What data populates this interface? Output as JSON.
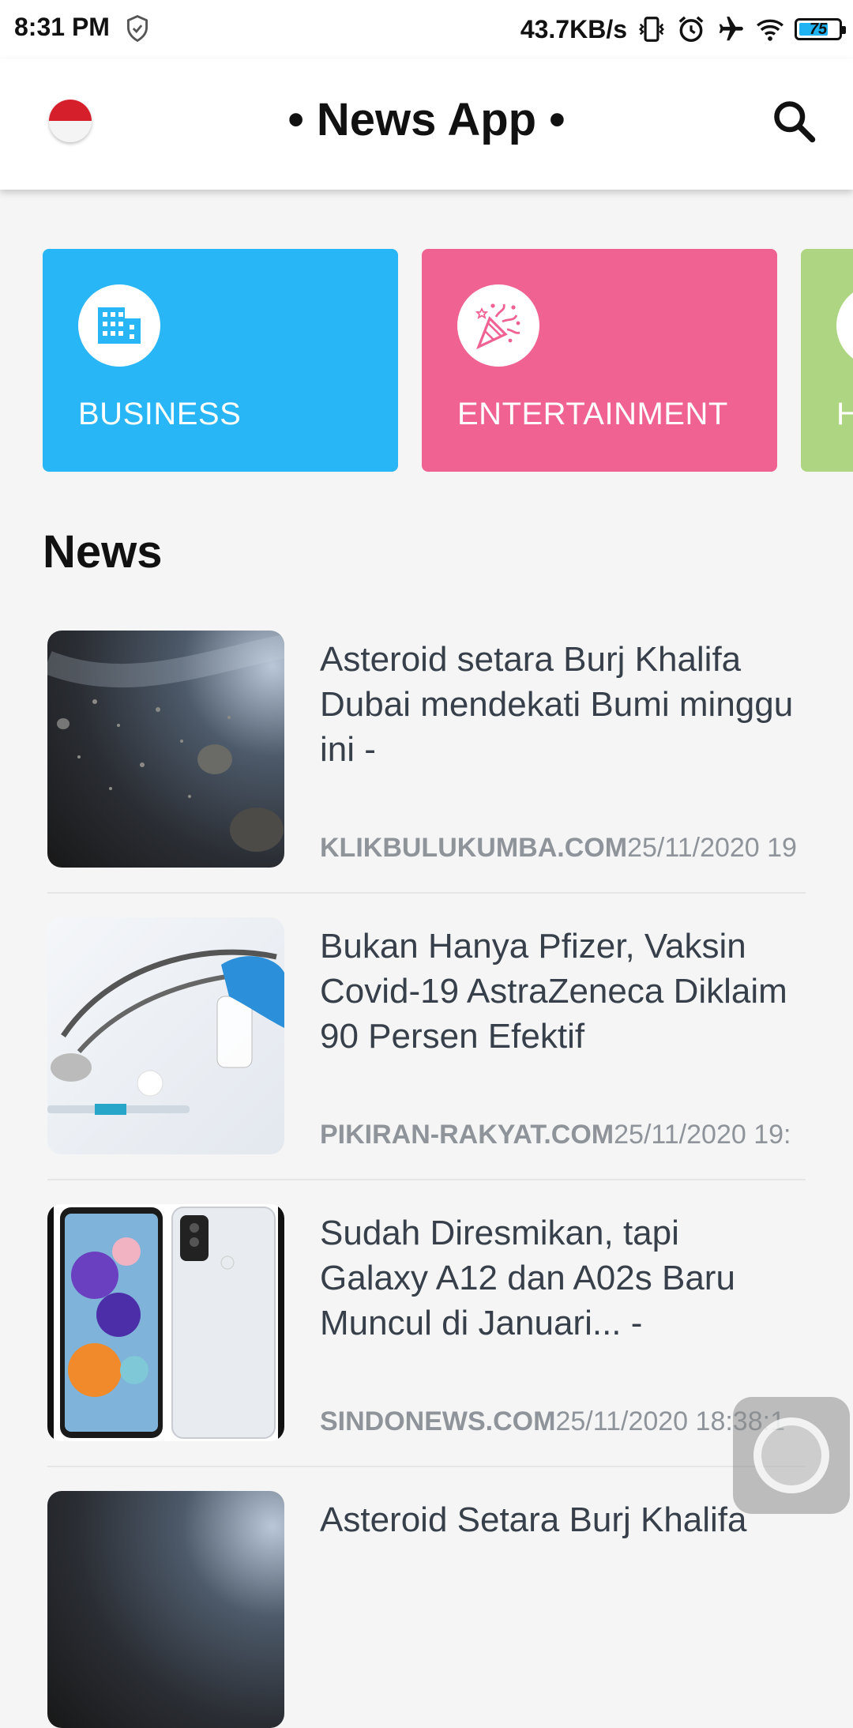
{
  "status_bar": {
    "time": "8:31 PM",
    "net_speed": "43.7KB/s",
    "battery": "75",
    "battery_level": 0.75,
    "icons": [
      "shield-icon",
      "vibrate-icon",
      "alarm-icon",
      "airplane-icon",
      "wifi-icon",
      "battery-icon"
    ]
  },
  "app_bar": {
    "title": "• News App •",
    "flag_icon": "indonesia-flag-icon",
    "search_icon": "search-icon"
  },
  "categories": [
    {
      "label": "BUSINESS",
      "color": "#29b6f6",
      "icon": "business-building-icon"
    },
    {
      "label": "ENTERTAINMENT",
      "color": "#f06292",
      "icon": "party-popper-icon"
    },
    {
      "label": "HEALTH",
      "color": "#aed581",
      "icon": "health-icon"
    }
  ],
  "section_title": "News",
  "news": [
    {
      "headline": "Asteroid setara Burj Khalifa Dubai mendekati Bumi minggu ini -",
      "source": "KLIKBULUKUMBA.COM",
      "datetime": "25/11/2020 19",
      "thumb": "asteroid-image"
    },
    {
      "headline": "Bukan Hanya Pfizer, Vaksin Covid-19 AstraZeneca Diklaim 90 Persen Efektif",
      "source": "PIKIRAN-RAKYAT.COM",
      "datetime": "25/11/2020 19:",
      "thumb": "vaccine-stethoscope-image"
    },
    {
      "headline": "Sudah Diresmikan, tapi Galaxy A12 dan A02s Baru Muncul di Januari... -",
      "source": "SINDONEWS.COM",
      "datetime": "25/11/2020 18:38:1",
      "thumb": "galaxy-phones-image"
    },
    {
      "headline": "Asteroid Setara Burj Khalifa",
      "source": "",
      "datetime": "",
      "thumb": "asteroid-image"
    }
  ],
  "colors": {
    "business": "#29b6f6",
    "entertainment": "#f06292",
    "health": "#aed581",
    "headline_text": "#37404a",
    "meta_text": "#8f949a"
  }
}
